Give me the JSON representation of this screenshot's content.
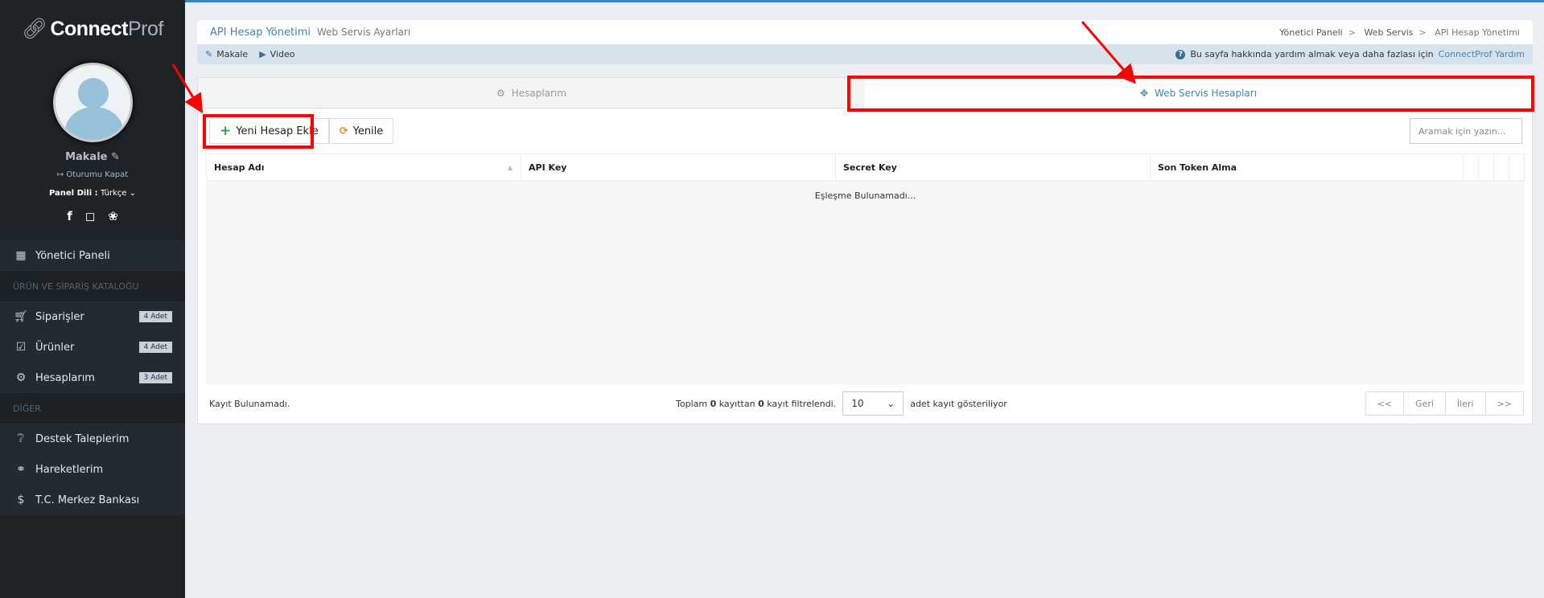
{
  "brand": {
    "logo_bold": "Connect",
    "logo_light": "Prof"
  },
  "user": {
    "name": "Makale",
    "logout": "Oturumu Kapat",
    "lang_label": "Panel Dili :",
    "lang_value": "Türkçe"
  },
  "social": [
    "facebook-icon",
    "instagram-icon",
    "twitter-icon"
  ],
  "sidebar": {
    "dashboard": "Yönetici Paneli",
    "section1": "ÜRÜN VE SİPARİŞ KATALOĞU",
    "items1": [
      {
        "label": "Siparişler",
        "badge": "4 Adet"
      },
      {
        "label": "Ürünler",
        "badge": "4 Adet"
      },
      {
        "label": "Hesaplarım",
        "badge": "3 Adet"
      }
    ],
    "section2": "DİĞER",
    "items2": [
      {
        "label": "Destek Taleplerim"
      },
      {
        "label": "Hareketlerim"
      },
      {
        "label": "T.C. Merkez Bankası"
      }
    ]
  },
  "header": {
    "title": "API Hesap Yönetimi",
    "subtitle": "Web Servis Ayarları",
    "breadcrumb": [
      "Yönetici Paneli",
      "Web Servis",
      "API Hesap Yönetimi"
    ]
  },
  "help": {
    "article": "Makale",
    "video": "Video",
    "text": "Bu sayfa hakkında yardım almak veya daha fazlası için",
    "link": "ConnectProf Yardım"
  },
  "tabs": [
    {
      "label": "Hesaplarım",
      "active": false
    },
    {
      "label": "Web Servis Hesapları",
      "active": true
    }
  ],
  "toolbar": {
    "add": "Yeni Hesap Ekle",
    "refresh": "Yenile",
    "search_placeholder": "Aramak için yazın..."
  },
  "table": {
    "columns": [
      "Hesap Adı",
      "API Key",
      "Secret Key",
      "Son Token Alma"
    ],
    "empty": "Eşleşme Bulunamadı..."
  },
  "footer": {
    "status": "Kayıt Bulunamadı.",
    "t1": "Toplam",
    "total": "0",
    "t2": "kayıttan",
    "filtered": "0",
    "t3": "kayıt filtrelendi.",
    "page_size": "10",
    "t4": "adet kayıt gösteriliyor",
    "pager": [
      "<<",
      "Geri",
      "İleri",
      ">>"
    ]
  },
  "colors": {
    "accent": "#3d85b8",
    "highlight": "#ff0000",
    "sidebar": "#1e2327"
  }
}
